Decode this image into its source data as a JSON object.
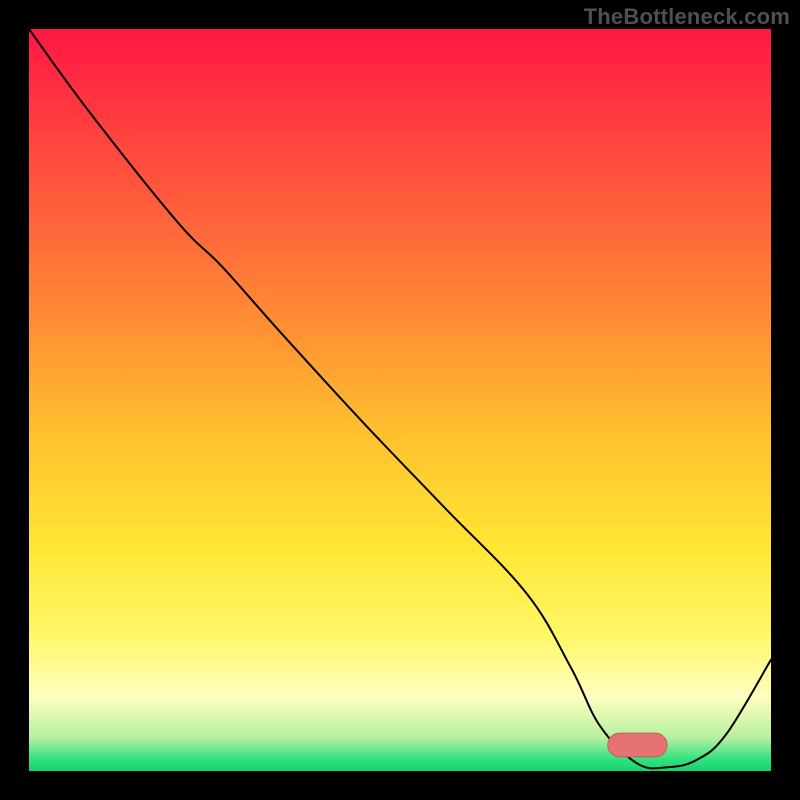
{
  "watermark": "TheBottleneck.com",
  "chart_data": {
    "type": "line",
    "title": "",
    "xlabel": "",
    "ylabel": "",
    "xlim": [
      0,
      100
    ],
    "ylim": [
      0,
      100
    ],
    "axes_visible": false,
    "background": "rainbow-gradient",
    "gradient_stops": [
      {
        "offset": 0.0,
        "color": "#ff1744"
      },
      {
        "offset": 0.12,
        "color": "#ff3b3f"
      },
      {
        "offset": 0.28,
        "color": "#ff6a3a"
      },
      {
        "offset": 0.4,
        "color": "#ff8f33"
      },
      {
        "offset": 0.55,
        "color": "#ffc22e"
      },
      {
        "offset": 0.7,
        "color": "#ffe635"
      },
      {
        "offset": 0.82,
        "color": "#fff86a"
      },
      {
        "offset": 0.9,
        "color": "#ffffc0"
      },
      {
        "offset": 0.955,
        "color": "#b7f0a0"
      },
      {
        "offset": 0.985,
        "color": "#2fe07e"
      },
      {
        "offset": 1.0,
        "color": "#17d36f"
      }
    ],
    "series": [
      {
        "name": "bottleneck-curve",
        "color": "#000000",
        "stroke_width": 2,
        "x": [
          0,
          8,
          20,
          26,
          34,
          45,
          56,
          67,
          73,
          77,
          82,
          86,
          90,
          94,
          100
        ],
        "y": [
          100,
          89,
          74,
          68,
          59,
          47,
          35.5,
          24,
          14,
          6,
          1,
          0.5,
          1.5,
          5,
          15
        ]
      }
    ],
    "marker": {
      "name": "optimal-range-pill",
      "x_start": 78,
      "x_end": 86,
      "y": 3.5,
      "height": 3.2,
      "fill": "#e57373",
      "stroke": "#c85a5a"
    }
  }
}
